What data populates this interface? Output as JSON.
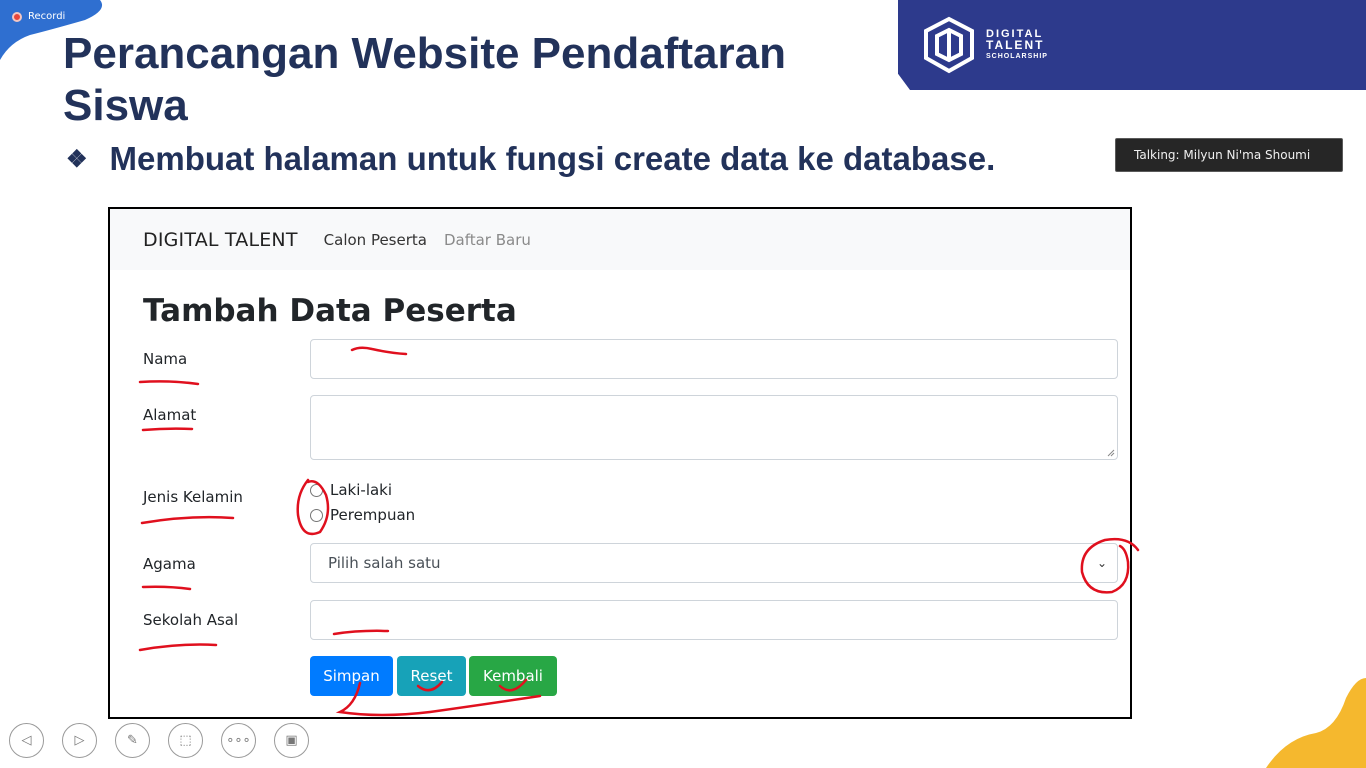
{
  "recording": {
    "label": "Recordi"
  },
  "slide": {
    "title": "Perancangan Website  Pendaftaran Siswa",
    "bullet_icon": "❖",
    "subtitle": "Membuat halaman untuk fungsi create data ke database."
  },
  "logo": {
    "line1": "DIGITAL",
    "line2": "TALENT",
    "line3": "SCHOLARSHIP"
  },
  "talking": {
    "text": "Talking: Milyun Ni'ma Shoumi"
  },
  "app": {
    "navbar": {
      "brand": "DIGITAL TALENT",
      "links": [
        "Calon Peserta",
        "Daftar Baru"
      ]
    },
    "heading": "Tambah Data Peserta",
    "form": {
      "nama_label": "Nama",
      "alamat_label": "Alamat",
      "jk_label": "Jenis Kelamin",
      "jk_options": [
        "Laki-laki",
        "Perempuan"
      ],
      "agama_label": "Agama",
      "agama_selected": "Pilih salah satu",
      "sekolah_label": "Sekolah Asal"
    },
    "buttons": {
      "simpan": "Simpan",
      "reset": "Reset",
      "kembali": "Kembali"
    }
  },
  "colors": {
    "primary": "#007bff",
    "info": "#17a2b8",
    "success": "#28a745",
    "title": "#22325a",
    "banner": "#2d3a8c",
    "ink": "#e0101e"
  },
  "toolbar_icons": [
    "prev-icon",
    "next-icon",
    "pen-icon",
    "pointer-icon",
    "more-icon",
    "screen-icon"
  ]
}
